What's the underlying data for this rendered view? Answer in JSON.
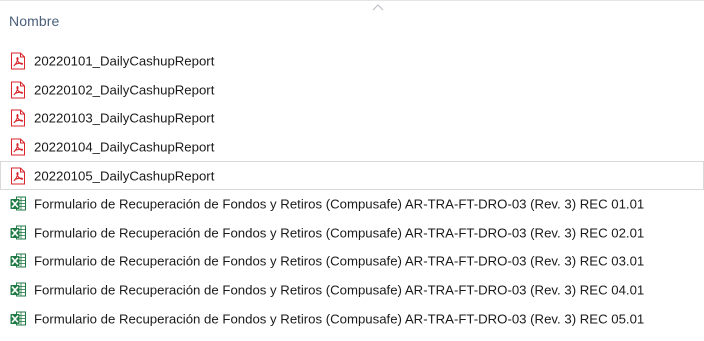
{
  "header": {
    "column_name": "Nombre",
    "sort_icon": "chevron-up-icon"
  },
  "files": [
    {
      "name": "20220101_DailyCashupReport",
      "icon": "pdf-icon",
      "type": "pdf",
      "focused": false
    },
    {
      "name": "20220102_DailyCashupReport",
      "icon": "pdf-icon",
      "type": "pdf",
      "focused": false
    },
    {
      "name": "20220103_DailyCashupReport",
      "icon": "pdf-icon",
      "type": "pdf",
      "focused": false
    },
    {
      "name": "20220104_DailyCashupReport",
      "icon": "pdf-icon",
      "type": "pdf",
      "focused": false
    },
    {
      "name": "20220105_DailyCashupReport",
      "icon": "pdf-icon",
      "type": "pdf",
      "focused": true
    },
    {
      "name": "Formulario de Recuperación de Fondos y Retiros (Compusafe) AR-TRA-FT-DRO-03 (Rev. 3) REC 01.01",
      "icon": "excel-icon",
      "type": "xlsx",
      "focused": false
    },
    {
      "name": "Formulario de Recuperación de Fondos y Retiros (Compusafe) AR-TRA-FT-DRO-03 (Rev. 3) REC 02.01",
      "icon": "excel-icon",
      "type": "xlsx",
      "focused": false
    },
    {
      "name": "Formulario de Recuperación de Fondos y Retiros (Compusafe) AR-TRA-FT-DRO-03 (Rev. 3) REC 03.01",
      "icon": "excel-icon",
      "type": "xlsx",
      "focused": false
    },
    {
      "name": "Formulario de Recuperación de Fondos y Retiros (Compusafe) AR-TRA-FT-DRO-03 (Rev. 3) REC 04.01",
      "icon": "excel-icon",
      "type": "xlsx",
      "focused": false
    },
    {
      "name": "Formulario de Recuperación de Fondos y Retiros (Compusafe) AR-TRA-FT-DRO-03 (Rev. 3) REC 05.01",
      "icon": "excel-icon",
      "type": "xlsx",
      "focused": false
    }
  ],
  "colors": {
    "header_text": "#4c607a",
    "pdf_red": "#d9262c",
    "excel_green": "#1f7a45"
  }
}
